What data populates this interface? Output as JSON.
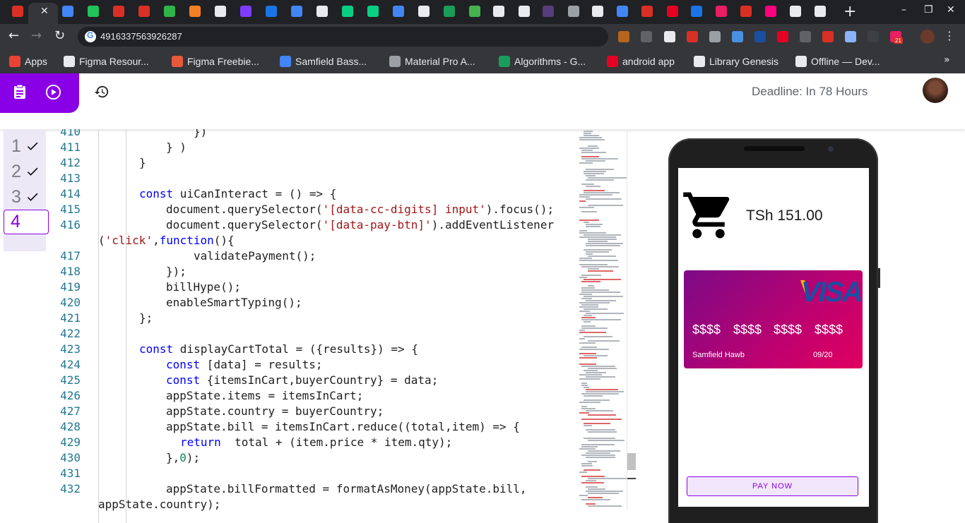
{
  "browser": {
    "tab_close_glyph": "✕",
    "new_tab_glyph": "+",
    "window_controls": [
      "–",
      "❐",
      "✕"
    ],
    "nav": {
      "back": "←",
      "forward": "→",
      "reload": "↻"
    },
    "address_value": "4916337563926287",
    "menu_glyph": "⋮",
    "tab_favicon_colors": [
      "#d93025",
      "#5f6368",
      "#4285f4",
      "#23c35c",
      "#d93025",
      "#d93025",
      "#2fb34a",
      "#f48024",
      "#e8eaed",
      "#7d3cff",
      "#1a73e8",
      "#4285f4",
      "#e8eaed",
      "#0acf83",
      "#0acf83",
      "#4285f4",
      "#e8eaed",
      "#1a9c5a",
      "#45b14f",
      "#e8eaed",
      "#e8eaed",
      "#563d7c",
      "#9aa0a6",
      "#e8eaed",
      "#4285f4",
      "#d93025",
      "#e60023",
      "#1a73e8",
      "#e91e63",
      "#d93025",
      "#ff0080",
      "#e8eaed",
      "#e8eaed"
    ],
    "extension_colors": [
      "#b5651d",
      "#5f6368",
      "#e8eaed",
      "#d93025",
      "#9aa0a6",
      "#4a90e2",
      "#1a4fa2",
      "#e60023",
      "#5f6368",
      "#d93025",
      "#8ab4f8",
      "#3c4043",
      "#e91e63"
    ],
    "extension_badge": "21",
    "bookmarks": {
      "more_glyph": "»",
      "items": [
        {
          "label": "Apps",
          "color": "#ea4335"
        },
        {
          "label": "Figma Resour...",
          "color": "#e8eaed"
        },
        {
          "label": "Figma Freebie...",
          "color": "#e8583a"
        },
        {
          "label": "Samfield Bass...",
          "color": "#4285f4"
        },
        {
          "label": "Material Pro A...",
          "color": "#9aa0a6"
        },
        {
          "label": "Algorithms - G...",
          "color": "#1a9c5a"
        },
        {
          "label": "android app",
          "color": "#e60023"
        },
        {
          "label": "Library Genesis",
          "color": "#e8eaed"
        },
        {
          "label": "Offline — Dev...",
          "color": "#e8eaed"
        }
      ]
    }
  },
  "app": {
    "deadline": "Deadline: In 78 Hours",
    "accent": "#8a00e6",
    "steps": [
      {
        "number": "1",
        "done": true
      },
      {
        "number": "2",
        "done": true
      },
      {
        "number": "3",
        "done": true
      },
      {
        "number": "4",
        "done": false
      }
    ]
  },
  "code": {
    "lines": [
      {
        "n": "410",
        "indent": 5,
        "t": [
          [
            "p",
            "})"
          ]
        ]
      },
      {
        "n": "411",
        "indent": 4,
        "t": [
          [
            "p",
            "} )"
          ]
        ]
      },
      {
        "n": "412",
        "indent": 3,
        "t": [
          [
            "p",
            "}"
          ]
        ]
      },
      {
        "n": "413",
        "indent": 0,
        "t": []
      },
      {
        "n": "414",
        "indent": 3,
        "t": [
          [
            "k",
            "const"
          ],
          [
            "p",
            " uiCanInteract = () => {"
          ]
        ]
      },
      {
        "n": "415",
        "indent": 4,
        "t": [
          [
            "p",
            "document.querySelector("
          ],
          [
            "s",
            "'[data-cc-digits] input'"
          ],
          [
            "p",
            ").focus();"
          ]
        ]
      },
      {
        "n": "416",
        "indent": 4,
        "t": [
          [
            "p",
            "document.querySelector("
          ],
          [
            "s",
            "'[data-pay-btn]'"
          ],
          [
            "p",
            ").addEventListener"
          ]
        ]
      },
      {
        "n": "",
        "indent": 0,
        "t": [
          [
            "p",
            "("
          ],
          [
            "s",
            "'click'"
          ],
          [
            "p",
            ","
          ],
          [
            "k",
            "function"
          ],
          [
            "p",
            "(){"
          ]
        ]
      },
      {
        "n": "417",
        "indent": 5,
        "t": [
          [
            "p",
            "validatePayment();"
          ]
        ]
      },
      {
        "n": "418",
        "indent": 4,
        "t": [
          [
            "p",
            "});"
          ]
        ]
      },
      {
        "n": "419",
        "indent": 4,
        "t": [
          [
            "p",
            "billHype();"
          ]
        ]
      },
      {
        "n": "420",
        "indent": 4,
        "t": [
          [
            "p",
            "enableSmartTyping();"
          ]
        ]
      },
      {
        "n": "421",
        "indent": 3,
        "t": [
          [
            "p",
            "};"
          ]
        ]
      },
      {
        "n": "422",
        "indent": 0,
        "t": []
      },
      {
        "n": "423",
        "indent": 3,
        "t": [
          [
            "k",
            "const"
          ],
          [
            "p",
            " displayCartTotal = ({results}) => {"
          ]
        ]
      },
      {
        "n": "424",
        "indent": 4,
        "t": [
          [
            "k",
            "const"
          ],
          [
            "p",
            " [data] = results;"
          ]
        ]
      },
      {
        "n": "425",
        "indent": 4,
        "t": [
          [
            "k",
            "const"
          ],
          [
            "p",
            " {itemsInCart,buyerCountry} = data;"
          ]
        ]
      },
      {
        "n": "426",
        "indent": 4,
        "t": [
          [
            "p",
            "appState.items = itemsInCart;"
          ]
        ]
      },
      {
        "n": "427",
        "indent": 4,
        "t": [
          [
            "p",
            "appState.country = buyerCountry;"
          ]
        ]
      },
      {
        "n": "428",
        "indent": 4,
        "t": [
          [
            "p",
            "appState.bill = itemsInCart.reduce((total,item) => {"
          ]
        ]
      },
      {
        "n": "429",
        "indent": 5,
        "t": [
          [
            "k",
            "return"
          ],
          [
            "p",
            "  total + (item.price * item.qty);"
          ]
        ]
      },
      {
        "n": "430",
        "indent": 4,
        "t": [
          [
            "p",
            "},"
          ],
          [
            "n",
            "0"
          ],
          [
            "p",
            ");"
          ]
        ]
      },
      {
        "n": "431",
        "indent": 0,
        "t": []
      },
      {
        "n": "432",
        "indent": 4,
        "t": [
          [
            "p",
            "appState.billFormatted = formatAsMoney(appState.bill,"
          ]
        ]
      },
      {
        "n": "",
        "indent": 0,
        "t": [
          [
            "p",
            "appState.country);"
          ]
        ]
      }
    ]
  },
  "phone": {
    "total": "TSh 151.00",
    "card": {
      "brand": "VISA",
      "digit_groups": [
        "$$$$",
        "$$$$",
        "$$$$",
        "$$$$"
      ],
      "holder": "Samfield Hawb",
      "expiry": "09/20"
    },
    "pay_button": "PAY NOW"
  }
}
